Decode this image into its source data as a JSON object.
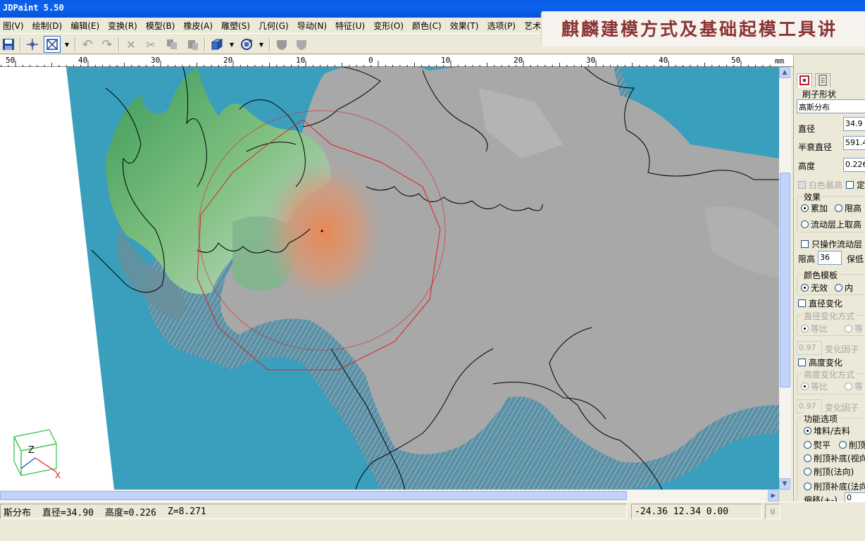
{
  "window": {
    "title": "JDPaint 5.50"
  },
  "overlay": {
    "text": "麒麟建模方式及基础起模工具讲"
  },
  "menu": [
    "图(V)",
    "绘制(D)",
    "编辑(E)",
    "变换(R)",
    "模型(B)",
    "橡皮(A)",
    "雕塑(S)",
    "几何(G)",
    "导动(N)",
    "特征(U)",
    "变形(O)",
    "颜色(C)",
    "效果(T)",
    "选项(P)",
    "艺术"
  ],
  "ruler": {
    "unit": "mm",
    "labels": [
      "50",
      "40",
      "30",
      "20",
      "10",
      "0",
      "10",
      "20",
      "30",
      "40",
      "50"
    ]
  },
  "axis": {
    "z": "Z",
    "x": "X"
  },
  "panel": {
    "shape_label": "刷子形状",
    "shape_value": "高斯分布",
    "diameter_label": "直径",
    "diameter_value": "34.9",
    "falloff_label": "半衰直径",
    "falloff_value": "591.4",
    "height_label": "高度",
    "height_value": "0.226",
    "white_highest": "白色最高",
    "fixed": "定",
    "effect_title": "效果",
    "effect_add": "累加",
    "effect_limit": "限高",
    "effect_flow": "流动层上取高",
    "only_flow": "只操作流动层",
    "limit_label": "限高",
    "limit_value": "36",
    "keep_low": "保低",
    "color_template": "颜色模板",
    "ct_none": "无效",
    "ct_in": "内",
    "dia_change": "直径变化",
    "dia_change_mode": "直径变化方式",
    "equal_ratio": "等比",
    "equal_diff": "等",
    "dia_factor_value": "0.97",
    "change_factor": "变化因子",
    "height_change": "高度变化",
    "height_change_mode": "高度变化方式",
    "height_factor_value": "0.97",
    "func_title": "功能选项",
    "f_pile": "堆料/去料",
    "f_flat": "熨平",
    "f_cut": "削顶",
    "f_cut_fill_view": "削顶补底(视向",
    "f_cut_normal": "削顶(法向)",
    "f_cut_fill_normal": "削顶补底(法向",
    "offset_label": "偏移(+-)",
    "offset_value": "0"
  },
  "status": {
    "brush": "斯分布",
    "diameter": "直径=34.90",
    "height": "高度=0.226",
    "z": "Z=8.271",
    "coords": "-24.36 12.34 0.00",
    "u_button": "U"
  }
}
